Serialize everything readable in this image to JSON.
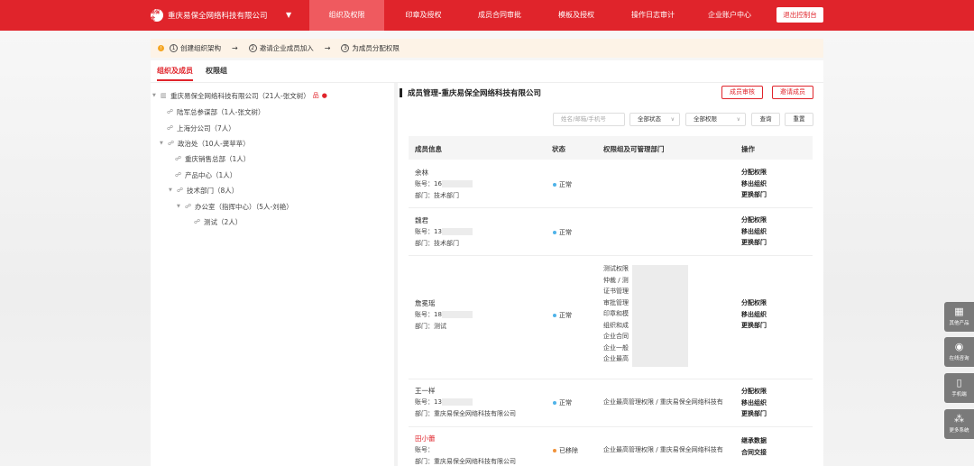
{
  "nav": {
    "brand_logo": "易保全",
    "brand_name": "重庆易保全网络科技有限公司",
    "items": [
      "组织及权限",
      "印章及授权",
      "成员合同审批",
      "模板及授权",
      "操作日志审计",
      "企业账户中心"
    ],
    "exit": "退出控制台"
  },
  "steps": {
    "items": [
      {
        "num": "1",
        "label": "创建组织架构"
      },
      {
        "num": "2",
        "label": "邀请企业成员加入"
      },
      {
        "num": "3",
        "label": "为成员分配权限"
      }
    ]
  },
  "tabs": [
    "组织及成员",
    "权限组"
  ],
  "tree": [
    {
      "label": "重庆易保全网络科技有限公司（21人-张文树）"
    },
    {
      "label": "陆军总参谋部（1人-张文树）"
    },
    {
      "label": "上海分公司（7人）"
    },
    {
      "label": "政治处（10人-龚苹苹）"
    },
    {
      "label": "重庆销售总部（1人）"
    },
    {
      "label": "产品中心（1人）"
    },
    {
      "label": "技术部门（8人）"
    },
    {
      "label": "办公室（指挥中心）（5人-刘艳）"
    },
    {
      "label": "测试（2人）"
    }
  ],
  "panel": {
    "title": "成员管理-重庆易保全网络科技有限公司",
    "btn_review": "成员审核",
    "btn_invite": "邀请成员",
    "search_placeholder": "姓名/邮箱/手机号",
    "status_select": "全部状态",
    "perm_select": "全部权限",
    "btn_query": "查询",
    "btn_reset": "重置"
  },
  "table": {
    "headers": [
      "成员信息",
      "状态",
      "权限组及可管理部门",
      "操作"
    ],
    "rows": [
      {
        "name": "余林",
        "account": "账号：16",
        "dept": "部门：技术部门",
        "status": "正常",
        "status_color": "#4fb3e8",
        "perms": [],
        "ops": [
          "分配权限",
          "移出组织",
          "更换部门"
        ]
      },
      {
        "name": "魏君",
        "account": "账号：13",
        "dept": "部门：技术部门",
        "status": "正常",
        "status_color": "#4fb3e8",
        "perms": [],
        "ops": [
          "分配权限",
          "移出组织",
          "更换部门"
        ]
      },
      {
        "name": "詹冕瑶",
        "account": "账号：18",
        "dept": "部门：测试",
        "status": "正常",
        "status_color": "#4fb3e8",
        "perms": [
          "测试权限",
          "仲裁 / 测",
          "证书管理",
          "审批管理",
          "印章和模",
          "组织和成",
          "企业合同",
          "企业一般",
          "企业最高"
        ],
        "ops": [
          "分配权限",
          "移出组织",
          "更换部门"
        ]
      },
      {
        "name": "王一样",
        "account": "账号：13",
        "dept": "部门：重庆易保全网络科技有限公司",
        "status": "正常",
        "status_color": "#4fb3e8",
        "perms": [
          "企业最高管理权限 / 重庆易保全网络科技有"
        ],
        "ops": [
          "分配权限",
          "移出组织",
          "更换部门"
        ]
      },
      {
        "name": "田小蕾",
        "account": "账号：",
        "dept": "部门：重庆易保全网络科技有限公司",
        "status": "已移除",
        "status_color": "#f0923a",
        "perms": [
          "企业最高管理权限 / 重庆易保全网络科技有"
        ],
        "ops": [
          "继承数据",
          "合同交接"
        ]
      }
    ]
  },
  "float": [
    {
      "label": "其他产品"
    },
    {
      "label": "在线咨询"
    },
    {
      "label": "手机端"
    },
    {
      "label": "更多系统"
    }
  ]
}
